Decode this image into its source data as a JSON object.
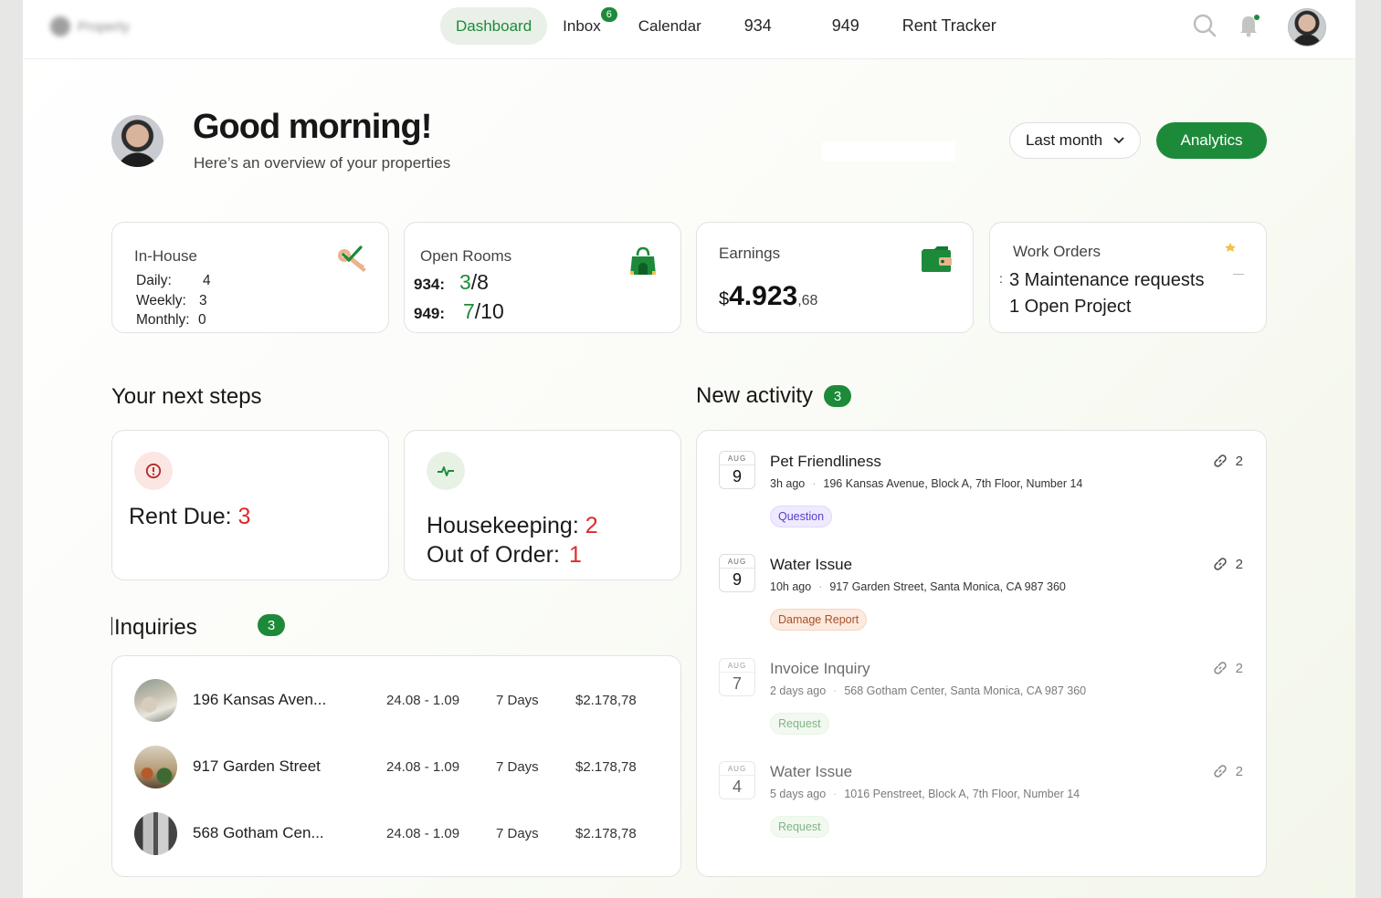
{
  "app": {
    "logo_text": "Property"
  },
  "nav": {
    "items": [
      {
        "label": "Dashboard",
        "active": true
      },
      {
        "label": "Inbox",
        "badge": "6"
      },
      {
        "label": "Calendar"
      },
      {
        "label": "934"
      },
      {
        "label": "949"
      },
      {
        "label": "Rent Tracker"
      }
    ],
    "icons": [
      "search-icon",
      "bell-icon",
      "avatar"
    ]
  },
  "header": {
    "greeting": "Good morning!",
    "subtitle": "Here’s an overview of your properties",
    "period_label": "Last month",
    "analytics_label": "Analytics"
  },
  "stats": {
    "inhouse": {
      "title": "In-House",
      "daily_label": "Daily:",
      "daily": "4",
      "weekly_label": "Weekly:",
      "weekly": "3",
      "monthly_label": "Monthly:",
      "monthly": "0"
    },
    "open_rooms": {
      "title": "Open Rooms",
      "r1_label": "934:",
      "r1_open": "3",
      "r1_total": "/8",
      "r2_label": "949:",
      "r2_open": "7",
      "r2_total": "/10"
    },
    "earnings": {
      "title": "Earnings",
      "currency": "$",
      "whole": "4.923",
      "cents": ",68"
    },
    "work_orders": {
      "title": "Work Orders",
      "line1": "3 Maintenance requests",
      "line2": "1 Open Project"
    }
  },
  "next_steps": {
    "title": "Your next steps",
    "rent_label": "Rent Due:",
    "rent_value": "3",
    "housekeeping_label": "Housekeeping:",
    "housekeeping_value": "2",
    "out_label": "Out of Order:",
    "out_value": "1"
  },
  "inquiries": {
    "title": "Inquiries",
    "count": "3",
    "rows": [
      {
        "name": "196 Kansas Aven...",
        "dates": "24.08 - 1.09",
        "days": "7 Days",
        "price": "$2.178,78"
      },
      {
        "name": "917 Garden Street",
        "dates": "24.08 - 1.09",
        "days": "7 Days",
        "price": "$2.178,78"
      },
      {
        "name": "568 Gotham Cen...",
        "dates": "24.08 - 1.09",
        "days": "7 Days",
        "price": "$2.178,78"
      }
    ]
  },
  "activity": {
    "title": "New activity",
    "count": "3",
    "items": [
      {
        "month": "AUG",
        "day": "9",
        "title": "Pet Friendliness",
        "ago": "3h ago",
        "address": "196 Kansas Avenue, Block A, 7th Floor, Number 14",
        "tag": "Question",
        "links": "2"
      },
      {
        "month": "AUG",
        "day": "9",
        "title": "Water Issue",
        "ago": "10h ago",
        "address": "917 Garden Street, Santa Monica, CA 987 360",
        "tag": "Damage Report",
        "links": "2"
      },
      {
        "month": "AUG",
        "day": "7",
        "title": "Invoice Inquiry",
        "ago": "2 days ago",
        "address": "568 Gotham Center, Santa Monica, CA 987 360",
        "tag": "Request",
        "links": "2"
      },
      {
        "month": "AUG",
        "day": "4",
        "title": "Water Issue",
        "ago": "5 days ago",
        "address": "1016 Penstreet, Block A, 7th Floor, Number 14",
        "tag": "Request",
        "links": "2"
      }
    ]
  },
  "colors": {
    "accent": "#1d8a3a",
    "alert": "#e0282a"
  }
}
